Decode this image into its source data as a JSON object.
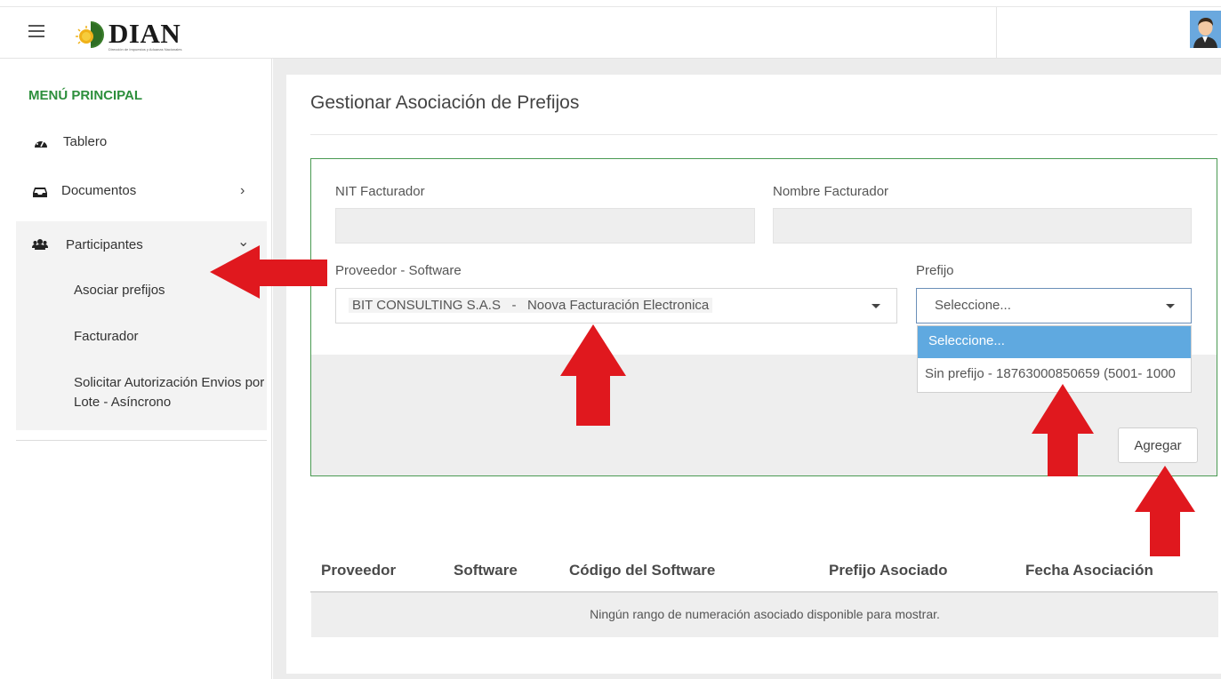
{
  "header": {
    "brand": "DIAN",
    "brand_tagline": "Dirección de Impuestos y Aduanas Nacionales"
  },
  "sidebar": {
    "title": "MENÚ PRINCIPAL",
    "items": [
      {
        "label": "Tablero",
        "icon": "dashboard-icon"
      },
      {
        "label": "Documentos",
        "icon": "inbox-icon",
        "chevron": "›"
      },
      {
        "label": "Participantes",
        "icon": "users-icon",
        "chevron": "⌄",
        "children": [
          {
            "label": "Asociar prefijos"
          },
          {
            "label": "Facturador"
          },
          {
            "label": "Solicitar Autorización Envios por Lote - Asíncrono"
          }
        ]
      }
    ]
  },
  "main": {
    "title": "Gestionar Asociación de Prefijos",
    "form": {
      "nit_label": "NIT Facturador",
      "nit_value": "",
      "nombre_label": "Nombre Facturador",
      "nombre_value": "",
      "proveedor_label": "Proveedor - Software",
      "proveedor_value": "BIT CONSULTING S.A.S   -   Noova Facturación Electronica",
      "prefijo_label": "Prefijo",
      "prefijo_value": "Seleccione...",
      "prefijo_options": [
        "Seleccione...",
        "Sin prefijo - 18763000850659 (5001- 1000"
      ],
      "add_button": "Agregar"
    },
    "table": {
      "columns": [
        "Proveedor",
        "Software",
        "Código del Software",
        "Prefijo Asociado",
        "Fecha Asociación"
      ],
      "empty_message": "Ningún rango de numeración asociado disponible para mostrar."
    }
  },
  "colors": {
    "accent_green": "#2d8f3c",
    "form_border": "#4a9a52",
    "dropdown_highlight": "#5fa9e0",
    "annotation_arrow": "#e0181e"
  }
}
